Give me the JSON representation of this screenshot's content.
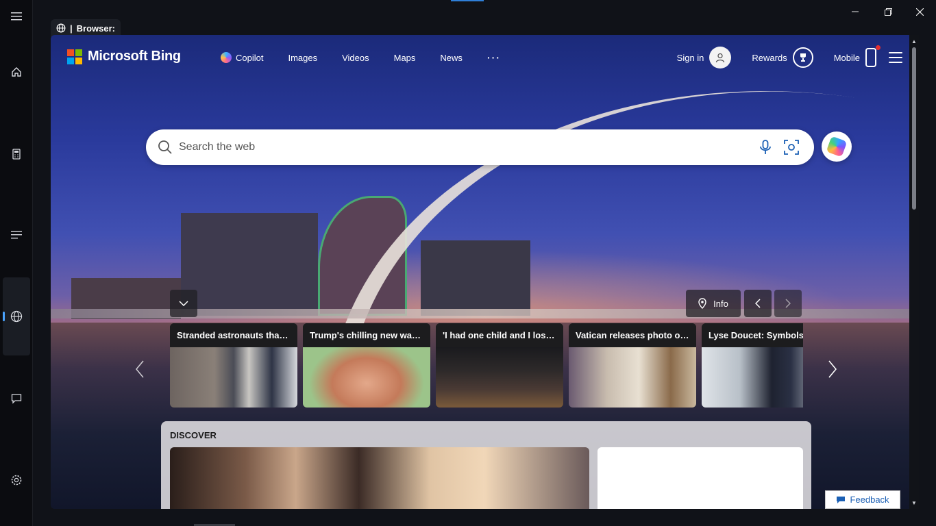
{
  "tab": {
    "label": "Browser:"
  },
  "bing": {
    "logo_text": "Microsoft Bing",
    "nav": [
      {
        "label": "Copilot"
      },
      {
        "label": "Images"
      },
      {
        "label": "Videos"
      },
      {
        "label": "Maps"
      },
      {
        "label": "News"
      },
      {
        "label": "···"
      }
    ],
    "sign_in": "Sign in",
    "rewards": "Rewards",
    "mobile": "Mobile",
    "search_placeholder": "Search the web",
    "info_label": "Info"
  },
  "news": [
    {
      "title": "Stranded astronauts thank ..."
    },
    {
      "title": "Trump's chilling new warni..."
    },
    {
      "title": "'I had one child and I lost h..."
    },
    {
      "title": "Vatican releases photo of P..."
    },
    {
      "title": "Lyse Doucet: Symbols ar"
    }
  ],
  "discover": {
    "label": "DISCOVER"
  },
  "feedback": "Feedback",
  "colors": {
    "accent": "#2f7fd8",
    "notification": "#e53030"
  }
}
